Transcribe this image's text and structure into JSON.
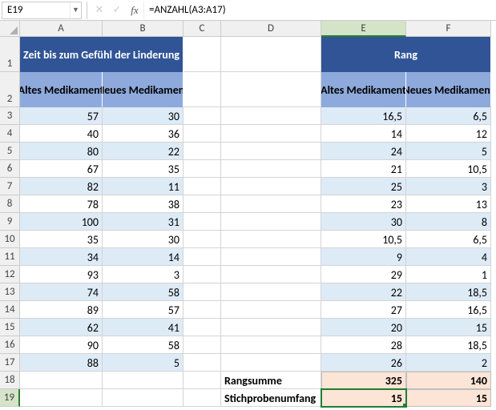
{
  "formula_bar": {
    "cell_ref": "E19",
    "formula": "=ANZAHL(A3:A17)",
    "fx_label": "fx"
  },
  "columns": [
    "A",
    "B",
    "C",
    "D",
    "E",
    "F"
  ],
  "rows": [
    "1",
    "2",
    "3",
    "4",
    "5",
    "6",
    "7",
    "8",
    "9",
    "10",
    "11",
    "12",
    "13",
    "14",
    "15",
    "16",
    "17",
    "18",
    "19"
  ],
  "headers": {
    "left_title": "Zeit bis zum Gefühl der Linderung",
    "right_title": "Rang",
    "sub_left_a": "Altes Medikament",
    "sub_left_b": "Neues Medikament",
    "sub_right_a": "Altes Medikament",
    "sub_right_b": "Neues Medikament"
  },
  "data": {
    "A": [
      "57",
      "40",
      "80",
      "67",
      "82",
      "78",
      "100",
      "35",
      "34",
      "93",
      "74",
      "89",
      "62",
      "90",
      "88"
    ],
    "B": [
      "30",
      "36",
      "22",
      "35",
      "11",
      "38",
      "31",
      "30",
      "14",
      "3",
      "58",
      "57",
      "41",
      "58",
      "5"
    ],
    "E": [
      "16,5",
      "14",
      "24",
      "21",
      "25",
      "23",
      "30",
      "10,5",
      "9",
      "29",
      "22",
      "27",
      "20",
      "28",
      "26"
    ],
    "F": [
      "6,5",
      "12",
      "5",
      "10,5",
      "3",
      "13",
      "8",
      "6,5",
      "4",
      "1",
      "18,5",
      "16,5",
      "15",
      "18,5",
      "2"
    ]
  },
  "summary": {
    "rangsumme_label": "Rangsumme",
    "rangsumme_E": "325",
    "rangsumme_F": "140",
    "stich_label": "Stichprobenumfang",
    "stich_E": "15",
    "stich_F": "15"
  },
  "selected_cell": "E19",
  "chart_data": {
    "type": "table",
    "title_left": "Zeit bis zum Gefühl der Linderung",
    "title_right": "Rang",
    "series": [
      {
        "name": "Altes Medikament (Zeit)",
        "values": [
          57,
          40,
          80,
          67,
          82,
          78,
          100,
          35,
          34,
          93,
          74,
          89,
          62,
          90,
          88
        ]
      },
      {
        "name": "Neues Medikament (Zeit)",
        "values": [
          30,
          36,
          22,
          35,
          11,
          38,
          31,
          30,
          14,
          3,
          58,
          57,
          41,
          58,
          5
        ]
      },
      {
        "name": "Altes Medikament (Rang)",
        "values": [
          16.5,
          14,
          24,
          21,
          25,
          23,
          30,
          10.5,
          9,
          29,
          22,
          27,
          20,
          28,
          26
        ]
      },
      {
        "name": "Neues Medikament (Rang)",
        "values": [
          6.5,
          12,
          5,
          10.5,
          3,
          13,
          8,
          6.5,
          4,
          1,
          18.5,
          16.5,
          15,
          18.5,
          2
        ]
      }
    ],
    "summary": {
      "Rangsumme": [
        325,
        140
      ],
      "Stichprobenumfang": [
        15,
        15
      ]
    }
  }
}
